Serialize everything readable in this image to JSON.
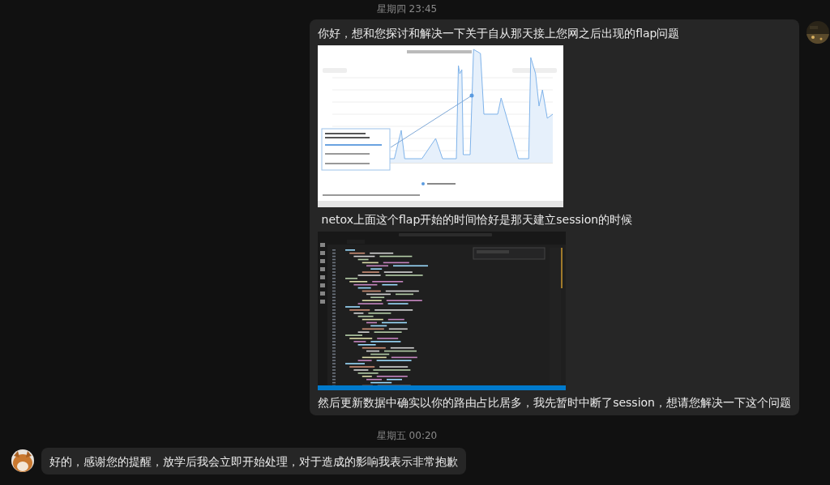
{
  "messages": [
    {
      "kind": "timestamp",
      "text": "星期四 23:45"
    },
    {
      "kind": "outgoing-bubble",
      "parts": [
        {
          "kind": "text",
          "text": "你好，想和您探讨和解决一下关于自从那天接上您网之后出现的flap问题"
        },
        {
          "kind": "chart-screenshot"
        },
        {
          "kind": "text",
          "text": " netox上面这个flap开始的时间恰好是那天建立session的时候"
        },
        {
          "kind": "code-screenshot"
        },
        {
          "kind": "text",
          "text": "然后更新数据中确实以你的路由占比居多，我先暂时中断了session，想请您解决一下这个问题"
        }
      ]
    },
    {
      "kind": "timestamp",
      "text": "星期五 00:20"
    },
    {
      "kind": "incoming-bubble",
      "parts": [
        {
          "kind": "text",
          "text": "好的，感谢您的提醒，放学后我会立即开始处理，对于造成的影响我表示非常抱歉"
        }
      ]
    }
  ]
}
